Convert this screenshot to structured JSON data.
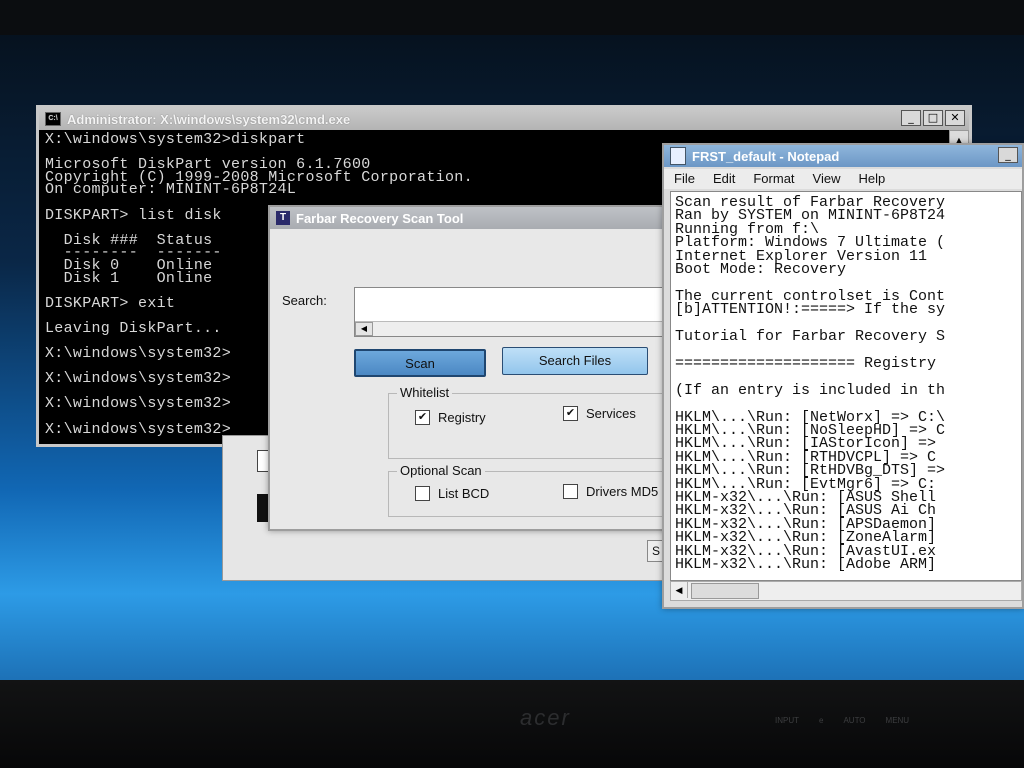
{
  "monitor": {
    "brand": "acer",
    "buttons": [
      "INPUT",
      "e",
      "AUTO",
      "MENU",
      "",
      "",
      ""
    ]
  },
  "cmd": {
    "title": "Administrator: X:\\windows\\system32\\cmd.exe",
    "lines": [
      "X:\\windows\\system32>diskpart",
      "",
      "Microsoft DiskPart version 6.1.7600",
      "Copyright (C) 1999-2008 Microsoft Corporation.",
      "On computer: MININT-6P8T24L",
      "",
      "DISKPART> list disk",
      "",
      "  Disk ###  Status",
      "  --------  -------",
      "  Disk 0    Online",
      "  Disk 1    Online",
      "",
      "DISKPART> exit",
      "",
      "Leaving DiskPart...",
      "",
      "X:\\windows\\system32>",
      "",
      "X:\\windows\\system32>",
      "",
      "X:\\windows\\system32>",
      "",
      "X:\\windows\\system32>"
    ]
  },
  "frst": {
    "title": "Farbar Recovery Scan Tool",
    "search_label": "Search:",
    "scan_label": "Scan",
    "search_files_label": "Search Files",
    "whitelist": {
      "title": "Whitelist",
      "registry": "Registry",
      "services": "Services"
    },
    "optional": {
      "title": "Optional Scan",
      "list_bcd": "List BCD",
      "drivers": "Drivers MD5"
    }
  },
  "notepad": {
    "title": "FRST_default - Notepad",
    "menu": [
      "File",
      "Edit",
      "Format",
      "View",
      "Help"
    ],
    "lines": [
      "Scan result of Farbar Recovery",
      "Ran by SYSTEM on MININT-6P8T24",
      "Running from f:\\",
      "Platform: Windows 7 Ultimate (",
      "Internet Explorer Version 11",
      "Boot Mode: Recovery",
      "",
      "The current controlset is Cont",
      "[b]ATTENTION!:=====> If the sy",
      "",
      "Tutorial for Farbar Recovery S",
      "",
      "==================== Registry",
      "",
      "(If an entry is included in th",
      "",
      "HKLM\\...\\Run: [NetWorx] => C:\\",
      "HKLM\\...\\Run: [NoSleepHD] => C",
      "HKLM\\...\\Run: [IAStorIcon] =>",
      "HKLM\\...\\Run: [RTHDVCPL] => C",
      "HKLM\\...\\Run: [RtHDVBg_DTS] =>",
      "HKLM\\...\\Run: [EvtMgr6] => C:",
      "HKLM-x32\\...\\Run: [ASUS Shell",
      "HKLM-x32\\...\\Run: [ASUS Ai Ch",
      "HKLM-x32\\...\\Run: [APSDaemon]",
      "HKLM-x32\\...\\Run: [ZoneAlarm]",
      "HKLM-x32\\...\\Run: [AvastUI.ex",
      "HKLM-x32\\...\\Run: [Adobe ARM]"
    ]
  }
}
